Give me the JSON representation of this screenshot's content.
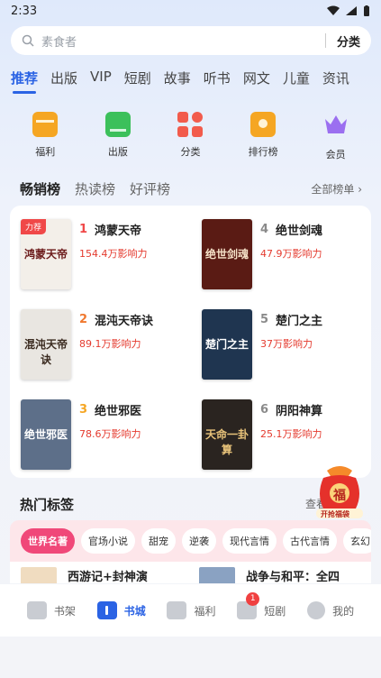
{
  "status": {
    "time": "2:33"
  },
  "search": {
    "placeholder": "素食者",
    "category": "分类"
  },
  "tabs": [
    "推荐",
    "出版",
    "VIP",
    "短剧",
    "故事",
    "听书",
    "网文",
    "儿童",
    "资讯"
  ],
  "quick": [
    {
      "label": "福利",
      "icon": "calendar-gift-icon",
      "color": "#f5a623"
    },
    {
      "label": "出版",
      "icon": "book-icon",
      "color": "#3cc05b"
    },
    {
      "label": "分类",
      "icon": "grid-icon",
      "color": "#f25b4c"
    },
    {
      "label": "排行榜",
      "icon": "ranking-icon",
      "color": "#f5a623"
    },
    {
      "label": "会员",
      "icon": "crown-icon",
      "color": "#9b6ff0"
    }
  ],
  "rank_tabs": {
    "items": [
      "畅销榜",
      "热读榜",
      "好评榜"
    ],
    "all": "全部榜单"
  },
  "books": [
    {
      "rank": "1",
      "title": "鸿蒙天帝",
      "influence": "154.4万影响力",
      "badge": "力荐",
      "cover_text": "鸿蒙天帝",
      "rank_color": "#f04848",
      "cover_bg": "#f3efe9",
      "cover_fg": "#6b1a1a"
    },
    {
      "rank": "4",
      "title": "绝世剑魂",
      "influence": "47.9万影响力",
      "cover_text": "绝世剑魂",
      "rank_color": "#8a8a8a",
      "cover_bg": "#5a1b14",
      "cover_fg": "#f5e1c8"
    },
    {
      "rank": "2",
      "title": "混沌天帝诀",
      "influence": "89.1万影响力",
      "cover_text": "混沌天帝诀",
      "rank_color": "#f0782e",
      "cover_bg": "#e9e6e1",
      "cover_fg": "#3a2a1f"
    },
    {
      "rank": "5",
      "title": "楚门之主",
      "influence": "37万影响力",
      "cover_text": "楚门之主",
      "rank_color": "#8a8a8a",
      "cover_bg": "#1f3550",
      "cover_fg": "#ffffff"
    },
    {
      "rank": "3",
      "title": "绝世邪医",
      "influence": "78.6万影响力",
      "cover_text": "绝世邪医",
      "rank_color": "#f5a623",
      "cover_bg": "#5d6f89",
      "cover_fg": "#ffffff"
    },
    {
      "rank": "6",
      "title": "阴阳神算",
      "influence": "25.1万影响力",
      "cover_text": "天命一卦算",
      "rank_color": "#8a8a8a",
      "cover_bg": "#2a2420",
      "cover_fg": "#e8c37a"
    }
  ],
  "hot_tags": {
    "title": "热门标签",
    "more": "查看",
    "tags": [
      "世界名著",
      "官场小说",
      "甜宠",
      "逆袭",
      "现代言情",
      "古代言情",
      "玄幻"
    ]
  },
  "tag_books": [
    {
      "title": "西游记+封神演"
    },
    {
      "title": "战争与和平：全四"
    }
  ],
  "fudai": {
    "label": "开抢福袋",
    "char": "福"
  },
  "nav": [
    {
      "label": "书架",
      "icon": "bookshelf-icon"
    },
    {
      "label": "书城",
      "icon": "bookstore-icon"
    },
    {
      "label": "福利",
      "icon": "gift-icon"
    },
    {
      "label": "短剧",
      "icon": "video-icon",
      "badge": "1"
    },
    {
      "label": "我的",
      "icon": "profile-icon"
    }
  ],
  "colors": {
    "accent": "#2b63e4",
    "influence": "#e43a2e",
    "hot_tag": "#f04879"
  }
}
